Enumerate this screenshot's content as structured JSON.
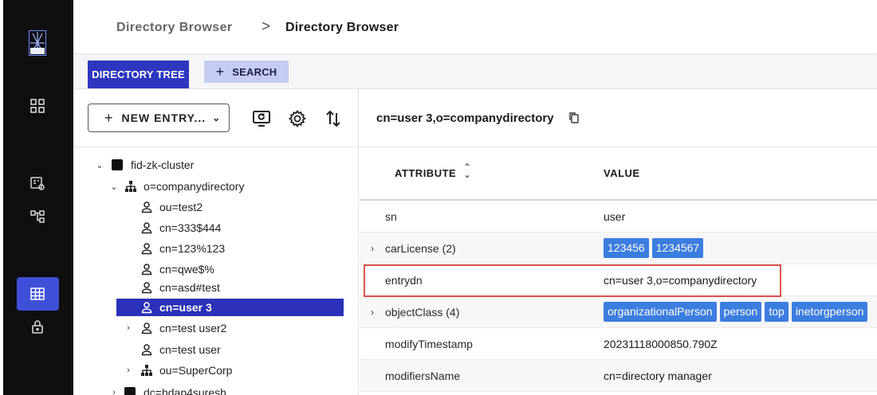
{
  "breadcrumb": {
    "parent": "Directory Browser",
    "separator": ">",
    "current": "Directory Browser"
  },
  "tabs": {
    "tree_label": "DIRECTORY TREE",
    "search_label": "SEARCH",
    "search_plus": "+"
  },
  "toolbar": {
    "new_entry_label": "NEW ENTRY...",
    "new_entry_plus": "+",
    "new_entry_chevron": "⌄"
  },
  "tree": {
    "cluster": "fid-zk-cluster",
    "org": "o=companydirectory",
    "items": [
      "ou=test2",
      "cn=333$444",
      "cn=123%123",
      "cn=qwe$%",
      "cn=asd#test",
      "cn=user 3",
      "cn=test user2",
      "cn=test user",
      "ou=SuperCorp"
    ],
    "next_root": "dc=hdap4suresh"
  },
  "details": {
    "dn": "cn=user 3,o=companydirectory",
    "col_attribute": "ATTRIBUTE",
    "col_value": "VALUE",
    "rows": [
      {
        "name": "sn",
        "value": "user"
      },
      {
        "name": "carLicense (2)",
        "chips": [
          "123456",
          "1234567"
        ]
      },
      {
        "name": "entrydn",
        "value": "cn=user 3,o=companydirectory"
      },
      {
        "name": "objectClass (4)",
        "chips": [
          "organizationalPerson",
          "person",
          "top",
          "inetorgperson"
        ]
      },
      {
        "name": "modifyTimestamp",
        "value": "20231118000850.790Z"
      },
      {
        "name": "modifiersName",
        "value": "cn=directory manager"
      }
    ]
  },
  "colors": {
    "rail": "#0f0f10",
    "accent": "#2f36c0",
    "chip": "#3c7de0",
    "highlight": "#d9534f"
  }
}
